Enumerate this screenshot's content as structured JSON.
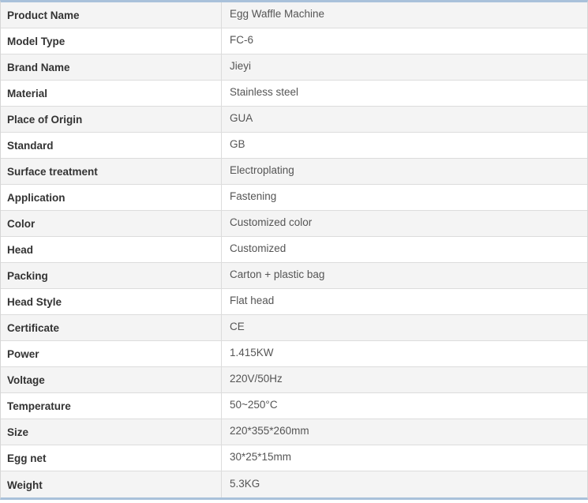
{
  "specs": [
    {
      "label": "Product Name",
      "value": "Egg Waffle Machine"
    },
    {
      "label": "Model Type",
      "value": "FC-6"
    },
    {
      "label": "Brand Name",
      "value": "Jieyi"
    },
    {
      "label": "Material",
      "value": "Stainless steel"
    },
    {
      "label": "Place of Origin",
      "value": "GUA"
    },
    {
      "label": "Standard",
      "value": "GB"
    },
    {
      "label": "Surface treatment",
      "value": "Electroplating"
    },
    {
      "label": "Application",
      "value": "Fastening"
    },
    {
      "label": "Color",
      "value": "Customized color"
    },
    {
      "label": "Head",
      "value": "Customized"
    },
    {
      "label": "Packing",
      "value": "Carton + plastic bag"
    },
    {
      "label": "Head Style",
      "value": "Flat head"
    },
    {
      "label": "Certificate",
      "value": "CE"
    },
    {
      "label": "Power",
      "value": "1.415KW"
    },
    {
      "label": "Voltage",
      "value": "220V/50Hz"
    },
    {
      "label": "Temperature",
      "value": "50~250°C"
    },
    {
      "label": "Size",
      "value": "220*355*260mm"
    },
    {
      "label": "Egg net",
      "value": "30*25*15mm"
    },
    {
      "label": "Weight",
      "value": "5.3KG"
    }
  ]
}
